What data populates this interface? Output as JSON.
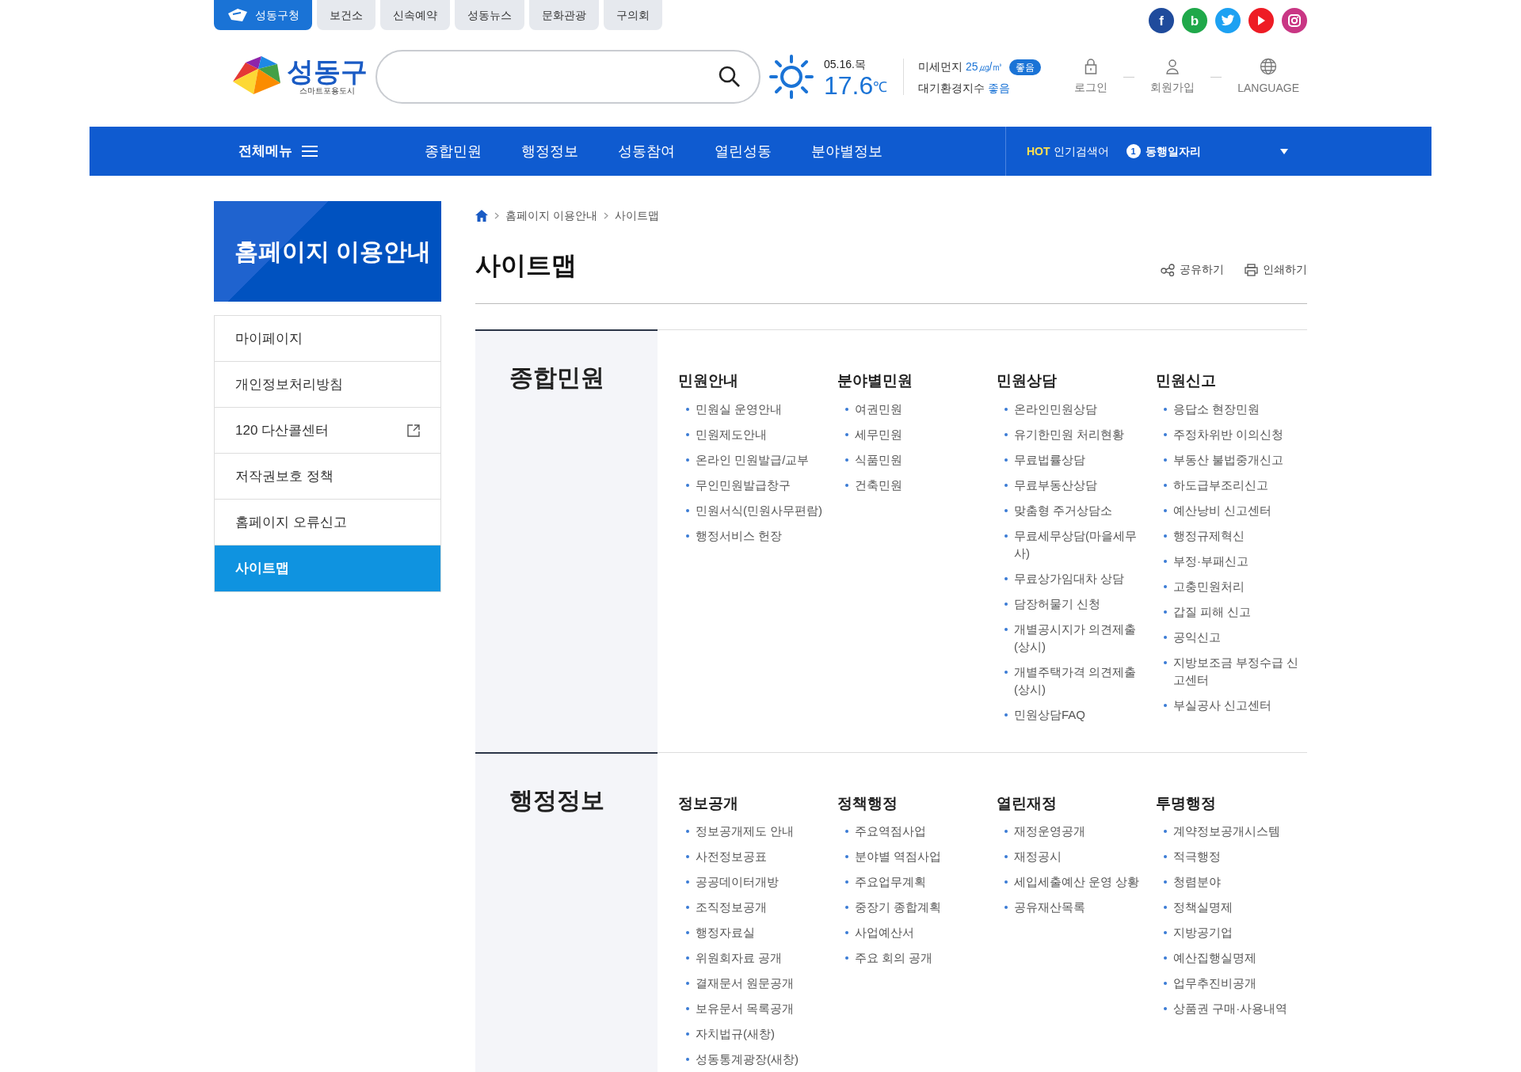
{
  "top_tabs": [
    {
      "label": "성동구청",
      "selected": true
    },
    {
      "label": "보건소",
      "selected": false
    },
    {
      "label": "신속예약",
      "selected": false
    },
    {
      "label": "성동뉴스",
      "selected": false
    },
    {
      "label": "문화관광",
      "selected": false
    },
    {
      "label": "구의회",
      "selected": false
    }
  ],
  "social": [
    {
      "kind": "facebook",
      "glyph": "f",
      "color": "#1f4b9c"
    },
    {
      "kind": "blog",
      "glyph": "b",
      "color": "#1fa84a"
    },
    {
      "kind": "twitter",
      "color": "#1da1f2"
    },
    {
      "kind": "youtube",
      "color": "#ee1c25"
    },
    {
      "kind": "instagram",
      "color": "#c93684"
    }
  ],
  "logo": {
    "name": "성동구",
    "tagline": "스마트포용도시"
  },
  "weather": {
    "date": "05.16.목",
    "temperature": "17.6",
    "unit": "℃"
  },
  "air": {
    "dust_label": "미세먼지",
    "dust_value": "25㎍/㎥",
    "dust_badge": "좋음",
    "index_label": "대기환경지수",
    "index_value": "좋음"
  },
  "utility": [
    {
      "kind": "login",
      "label": "로그인"
    },
    {
      "kind": "join",
      "label": "회원가입"
    },
    {
      "kind": "language",
      "label": "LANGUAGE"
    }
  ],
  "nav": {
    "menu_label": "전체메뉴",
    "items": [
      "종합민원",
      "행정정보",
      "성동참여",
      "열린성동",
      "분야별정보"
    ],
    "hot_tag": "HOT",
    "hot_label": "인기검색어",
    "hot_rank": "1",
    "hot_term": "동행일자리"
  },
  "sidebar": {
    "title": "홈페이지 이용안내",
    "items": [
      {
        "label": "마이페이지",
        "kind": "page",
        "selected": false
      },
      {
        "label": "개인정보처리방침",
        "kind": "page",
        "selected": false
      },
      {
        "label": "120 다산콜센터",
        "kind": "external",
        "selected": false
      },
      {
        "label": "저작권보호 정책",
        "kind": "page",
        "selected": false
      },
      {
        "label": "홈페이지 오류신고",
        "kind": "page",
        "selected": false
      },
      {
        "label": "사이트맵",
        "kind": "page",
        "selected": true
      }
    ]
  },
  "breadcrumb": [
    "홈페이지 이용안내",
    "사이트맵"
  ],
  "page_title": "사이트맵",
  "page_actions": [
    {
      "kind": "share",
      "label": "공유하기"
    },
    {
      "kind": "print",
      "label": "인쇄하기"
    }
  ],
  "sections": [
    {
      "title": "종합민원",
      "groups": [
        {
          "title": "민원안내",
          "items": [
            "민원실 운영안내",
            "민원제도안내",
            "온라인 민원발급/교부",
            "무인민원발급창구",
            "민원서식(민원사무편람)",
            "행정서비스 헌장"
          ]
        },
        {
          "title": "분야별민원",
          "items": [
            "여권민원",
            "세무민원",
            "식품민원",
            "건축민원"
          ]
        },
        {
          "title": "민원상담",
          "items": [
            "온라인민원상담",
            "유기한민원 처리현황",
            "무료법률상담",
            "무료부동산상담",
            "맞춤형 주거상담소",
            "무료세무상담(마을세무사)",
            "무료상가임대차 상담",
            "담장허물기 신청",
            "개별공시지가 의견제출(상시)",
            "개별주택가격 의견제출(상시)",
            "민원상담FAQ"
          ]
        },
        {
          "title": "민원신고",
          "items": [
            "응답소 현장민원",
            "주정차위반 이의신청",
            "부동산 불법중개신고",
            "하도급부조리신고",
            "예산낭비 신고센터",
            "행정규제혁신",
            "부정·부패신고",
            "고충민원처리",
            "갑질 피해 신고",
            "공익신고",
            "지방보조금 부정수급 신고센터",
            "부실공사 신고센터"
          ]
        }
      ]
    },
    {
      "title": "행정정보",
      "groups": [
        {
          "title": "정보공개",
          "items": [
            "정보공개제도 안내",
            "사전정보공표",
            "공공데이터개방",
            "조직정보공개",
            "행정자료실",
            "위원회자료 공개",
            "결재문서 원문공개",
            "보유문서 목록공개",
            "자치법규(새창)",
            "성동통계광장(새창)"
          ]
        },
        {
          "title": "정책행정",
          "items": [
            "주요역점사업",
            "분야별 역점사업",
            "주요업무계획",
            "중장기 종합계획",
            "사업예산서",
            "주요 회의 공개"
          ]
        },
        {
          "title": "열린재정",
          "items": [
            "재정운영공개",
            "재정공시",
            "세입세출예산 운영 상황",
            "공유재산목록"
          ]
        },
        {
          "title": "투명행정",
          "items": [
            "계약정보공개시스템",
            "적극행정",
            "청렴분야",
            "정책실명제",
            "지방공기업",
            "예산집행실명제",
            "업무추진비공개",
            "상품권 구매·사용내역"
          ]
        }
      ]
    }
  ]
}
